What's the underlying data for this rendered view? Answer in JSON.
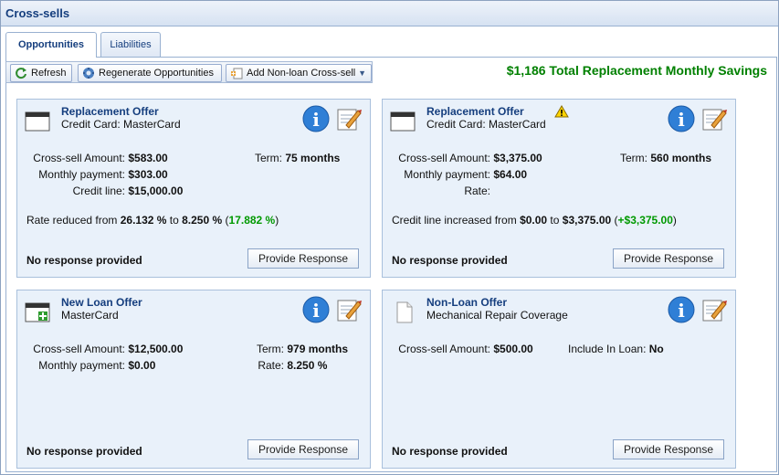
{
  "window": {
    "title": "Cross-sells"
  },
  "tabs": [
    {
      "label": "Opportunities",
      "active": true
    },
    {
      "label": "Liabilities",
      "active": false
    }
  ],
  "toolbar": {
    "refresh_label": "Refresh",
    "regenerate_label": "Regenerate Opportunities",
    "add_label": "Add Non-loan Cross-sell"
  },
  "summary": {
    "savings_text": "$1,186 Total Replacement Monthly Savings"
  },
  "cards": [
    {
      "title": "Replacement Offer",
      "subtitle": "Credit Card: MasterCard",
      "icon": "card-window-icon",
      "cross_sell_label": "Cross-sell Amount:",
      "cross_sell_value": "$583.00",
      "monthly_label": "Monthly payment:",
      "monthly_value": "$303.00",
      "credit_label": "Credit line:",
      "credit_value": "$15,000.00",
      "term_label": "Term:",
      "term_value": "75 months",
      "rate_prefix": "Rate reduced from ",
      "rate_from": "26.132 %",
      "rate_mid": " to ",
      "rate_to": "8.250 %",
      "rate_open": " (",
      "rate_delta": "17.882 %",
      "rate_close": ")",
      "response_status": "No response provided",
      "response_button": "Provide Response"
    },
    {
      "title": "Replacement Offer",
      "subtitle": "Credit Card: MasterCard",
      "icon": "card-window-icon",
      "warning": true,
      "cross_sell_label": "Cross-sell Amount:",
      "cross_sell_value": "$3,375.00",
      "monthly_label": "Monthly payment:",
      "monthly_value": "$64.00",
      "rate_label": "Rate:",
      "rate_value": "",
      "term_label": "Term:",
      "term_value": "560 months",
      "credit_prefix": "Credit line increased from ",
      "credit_from": "$0.00",
      "credit_mid": " to ",
      "credit_to": "$3,375.00",
      "credit_open": " (",
      "credit_delta": "+$3,375.00",
      "credit_close": ")",
      "response_status": "No response provided",
      "response_button": "Provide Response"
    },
    {
      "title": "New Loan Offer",
      "subtitle": "MasterCard",
      "icon": "new-loan-window-icon",
      "cross_sell_label": "Cross-sell Amount:",
      "cross_sell_value": "$12,500.00",
      "monthly_label": "Monthly payment:",
      "monthly_value": "$0.00",
      "term_label": "Term:",
      "term_value": "979 months",
      "rate_label": "Rate:",
      "rate_value": "8.250 %",
      "response_status": "No response provided",
      "response_button": "Provide Response"
    },
    {
      "title": "Non-Loan Offer",
      "subtitle": "Mechanical Repair Coverage",
      "icon": "document-icon",
      "cross_sell_label": "Cross-sell Amount:",
      "cross_sell_value": "$500.00",
      "include_label": "Include In Loan:",
      "include_value": "No",
      "response_status": "No response provided",
      "response_button": "Provide Response"
    }
  ],
  "colors": {
    "accent": "#153e7e",
    "savings": "#008000",
    "card_bg": "#e9f1fa",
    "delta_green": "#009900"
  }
}
